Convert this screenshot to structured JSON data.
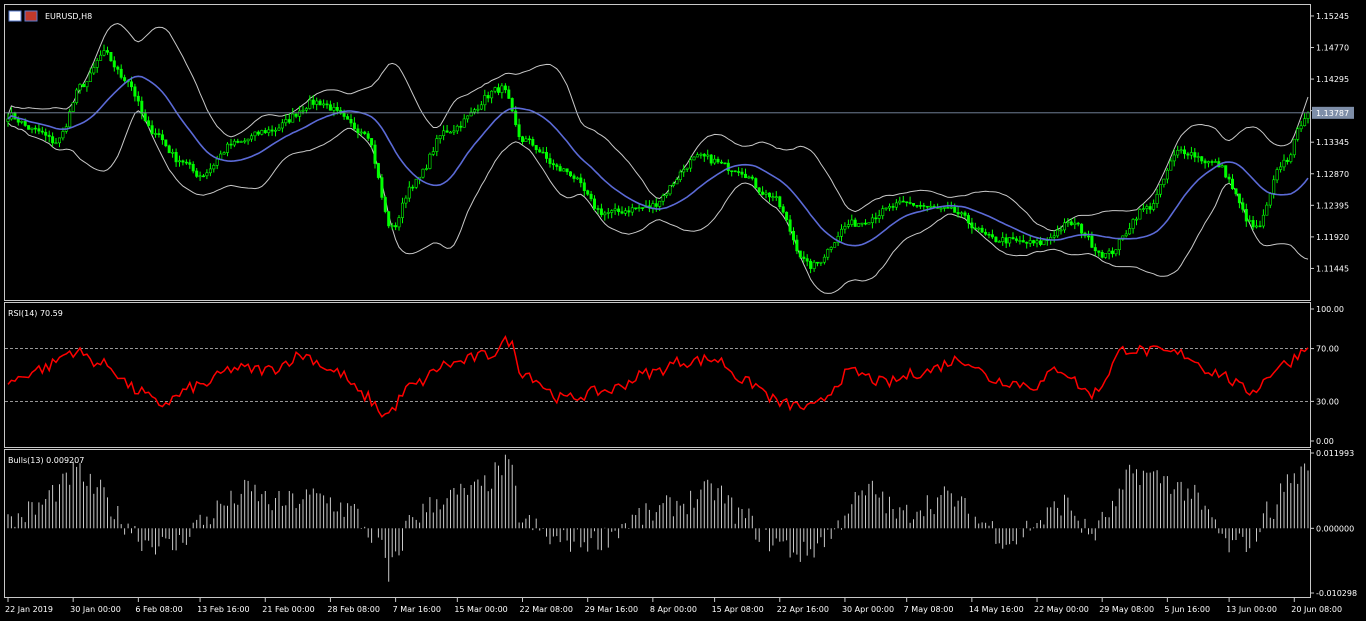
{
  "chart_data": [
    {
      "type": "candlestick",
      "panel_label": "EURUSD,H8",
      "ylim": [
        1.1097,
        1.1541
      ],
      "y_ticks": [
        "1.15245",
        "1.14770",
        "1.14295",
        "1.13820",
        "1.13345",
        "1.12870",
        "1.12395",
        "1.11920",
        "1.11445"
      ],
      "last_price_label": "1.13787",
      "last_price": 1.13787,
      "x_ticks": [
        "22 Jan 2019",
        "30 Jan 00:00",
        "6 Feb 08:00",
        "13 Feb 16:00",
        "21 Feb 00:00",
        "28 Feb 08:00",
        "7 Mar 16:00",
        "15 Mar 00:00",
        "22 Mar 08:00",
        "29 Mar 16:00",
        "8 Apr 00:00",
        "15 Apr 08:00",
        "22 Apr 16:00",
        "30 Apr 00:00",
        "7 May 08:00",
        "14 May 16:00",
        "22 May 00:00",
        "29 May 08:00",
        "5 Jun 16:00",
        "13 Jun 00:00",
        "20 Jun 08:00"
      ],
      "x_tick_index": [
        0,
        19,
        38,
        56,
        75,
        94,
        113,
        131,
        150,
        169,
        188,
        206,
        225,
        244,
        262,
        281,
        300,
        319,
        338,
        356,
        375
      ],
      "n_bars": 380,
      "close_anchors": [
        [
          0,
          1.1375
        ],
        [
          8,
          1.1352
        ],
        [
          14,
          1.1335
        ],
        [
          22,
          1.1422
        ],
        [
          28,
          1.1468
        ],
        [
          34,
          1.1431
        ],
        [
          42,
          1.1352
        ],
        [
          50,
          1.1308
        ],
        [
          56,
          1.1285
        ],
        [
          66,
          1.1332
        ],
        [
          76,
          1.1352
        ],
        [
          90,
          1.1395
        ],
        [
          104,
          1.1352
        ],
        [
          112,
          1.1205
        ],
        [
          118,
          1.1272
        ],
        [
          128,
          1.1352
        ],
        [
          144,
          1.1415
        ],
        [
          150,
          1.1338
        ],
        [
          162,
          1.1292
        ],
        [
          174,
          1.1228
        ],
        [
          186,
          1.1236
        ],
        [
          202,
          1.1312
        ],
        [
          212,
          1.1295
        ],
        [
          222,
          1.1255
        ],
        [
          234,
          1.1148
        ],
        [
          246,
          1.1212
        ],
        [
          262,
          1.1242
        ],
        [
          274,
          1.1232
        ],
        [
          288,
          1.1188
        ],
        [
          300,
          1.1182
        ],
        [
          310,
          1.1212
        ],
        [
          320,
          1.1165
        ],
        [
          332,
          1.1235
        ],
        [
          342,
          1.1322
        ],
        [
          352,
          1.1302
        ],
        [
          364,
          1.1205
        ],
        [
          372,
          1.1305
        ],
        [
          379,
          1.13787
        ]
      ],
      "series": [
        {
          "name": "",
          "color": "#5b6ad6",
          "kind": "moving-average"
        },
        {
          "name": "",
          "color": "#c8c8c8",
          "kind": "bollinger-bands"
        }
      ],
      "candle_color": "#00ff00",
      "grid": false
    },
    {
      "type": "line",
      "panel_label": "RSI(14) 70.59",
      "ylim": [
        0,
        100
      ],
      "y_ticks": [
        "100.00",
        "70.00",
        "30.00",
        "0.00"
      ],
      "levels": [
        70,
        30
      ],
      "line_color": "#ff0000",
      "anchors": [
        [
          0,
          45
        ],
        [
          10,
          55
        ],
        [
          19,
          68
        ],
        [
          28,
          58
        ],
        [
          38,
          38
        ],
        [
          44,
          28
        ],
        [
          56,
          42
        ],
        [
          66,
          55
        ],
        [
          76,
          54
        ],
        [
          86,
          65
        ],
        [
          96,
          52
        ],
        [
          104,
          34
        ],
        [
          110,
          20
        ],
        [
          118,
          42
        ],
        [
          128,
          58
        ],
        [
          140,
          65
        ],
        [
          146,
          76
        ],
        [
          150,
          52
        ],
        [
          162,
          32
        ],
        [
          174,
          38
        ],
        [
          188,
          52
        ],
        [
          196,
          60
        ],
        [
          206,
          62
        ],
        [
          216,
          44
        ],
        [
          226,
          28
        ],
        [
          234,
          25
        ],
        [
          246,
          52
        ],
        [
          256,
          44
        ],
        [
          266,
          52
        ],
        [
          278,
          62
        ],
        [
          288,
          46
        ],
        [
          300,
          42
        ],
        [
          306,
          55
        ],
        [
          316,
          36
        ],
        [
          326,
          70
        ],
        [
          332,
          68
        ],
        [
          342,
          66
        ],
        [
          352,
          52
        ],
        [
          362,
          38
        ],
        [
          372,
          58
        ],
        [
          379,
          70.59
        ]
      ]
    },
    {
      "type": "bar",
      "panel_label": "Bulls(13) 0.009207",
      "ylim": [
        -0.010298,
        0.011993
      ],
      "y_ticks": [
        "0.011993",
        "0.000000",
        "-0.010298"
      ],
      "bar_color": "#c8c8c8",
      "anchors": [
        [
          0,
          0.001
        ],
        [
          8,
          0.003
        ],
        [
          14,
          0.006
        ],
        [
          20,
          0.009
        ],
        [
          26,
          0.006
        ],
        [
          34,
          0.001
        ],
        [
          40,
          -0.002
        ],
        [
          48,
          -0.003
        ],
        [
          56,
          0.001
        ],
        [
          64,
          0.004
        ],
        [
          70,
          0.006
        ],
        [
          78,
          0.004
        ],
        [
          90,
          0.005
        ],
        [
          100,
          0.003
        ],
        [
          106,
          -0.001
        ],
        [
          112,
          -0.006
        ],
        [
          118,
          0.002
        ],
        [
          128,
          0.005
        ],
        [
          136,
          0.006
        ],
        [
          146,
          0.01
        ],
        [
          150,
          0.001
        ],
        [
          160,
          -0.002
        ],
        [
          170,
          -0.002
        ],
        [
          186,
          0.002
        ],
        [
          196,
          0.004
        ],
        [
          206,
          0.006
        ],
        [
          214,
          0.002
        ],
        [
          222,
          -0.002
        ],
        [
          232,
          -0.004
        ],
        [
          240,
          -0.001
        ],
        [
          246,
          0.004
        ],
        [
          252,
          0.006
        ],
        [
          260,
          0.002
        ],
        [
          268,
          0.004
        ],
        [
          274,
          0.005
        ],
        [
          284,
          0.001
        ],
        [
          292,
          -0.002
        ],
        [
          300,
          0.001
        ],
        [
          308,
          0.004
        ],
        [
          316,
          -0.001
        ],
        [
          322,
          0.003
        ],
        [
          328,
          0.009
        ],
        [
          336,
          0.008
        ],
        [
          344,
          0.006
        ],
        [
          350,
          0.002
        ],
        [
          356,
          -0.003
        ],
        [
          362,
          -0.002
        ],
        [
          368,
          0.003
        ],
        [
          374,
          0.008
        ],
        [
          379,
          0.009207
        ]
      ]
    }
  ]
}
